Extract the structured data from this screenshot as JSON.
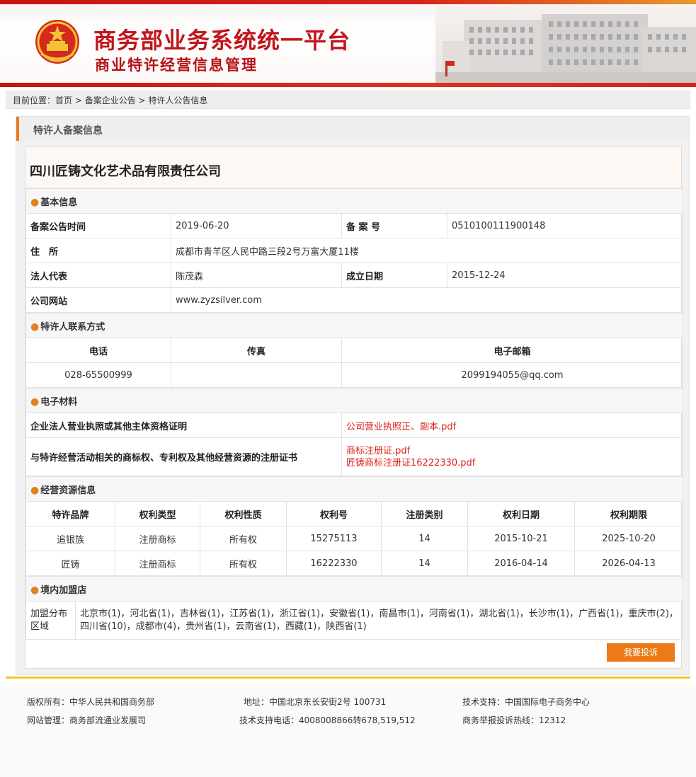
{
  "header": {
    "title": "商务部业务系统统一平台",
    "subtitle": "商业特许经营信息管理"
  },
  "breadcrumb": {
    "prefix": "目前位置：",
    "items": [
      "首页",
      "备案企业公告",
      "特许人公告信息"
    ],
    "sep": " > "
  },
  "panel": {
    "title": "特许人备案信息",
    "company": "四川匠铸文化艺术品有限责任公司"
  },
  "basic": {
    "section": "基本信息",
    "filing_date_label": "备案公告时间",
    "filing_date": "2019-06-20",
    "record_no_label": "备 案 号",
    "record_no": "0510100111900148",
    "address_label": "住　所",
    "address": "成都市青羊区人民中路三段2号万富大厦11楼",
    "legal_rep_label": "法人代表",
    "legal_rep": "陈茂森",
    "founded_label": "成立日期",
    "founded": "2015-12-24",
    "website_label": "公司网站",
    "website": "www.zyzsilver.com"
  },
  "contact": {
    "section": "特许人联系方式",
    "phone_label": "电话",
    "fax_label": "传真",
    "email_label": "电子邮箱",
    "phone": "028-65500999",
    "fax": "",
    "email": "2099194055@qq.com"
  },
  "materials": {
    "section": "电子材料",
    "row1_label": "企业法人营业执照或其他主体资格证明",
    "row1_file": "公司营业执照正、副本.pdf",
    "row2_label": "与特许经营活动相关的商标权、专利权及其他经营资源的注册证书",
    "row2_file1": "商标注册证.pdf",
    "row2_file2": "匠铸商标注册证16222330.pdf"
  },
  "resources": {
    "section": "经营资源信息",
    "headers": [
      "特许品牌",
      "权利类型",
      "权利性质",
      "权利号",
      "注册类别",
      "权利日期",
      "权利期限"
    ],
    "rows": [
      [
        "追银族",
        "注册商标",
        "所有权",
        "15275113",
        "14",
        "2015-10-21",
        "2025-10-20"
      ],
      [
        "匠铸",
        "注册商标",
        "所有权",
        "16222330",
        "14",
        "2016-04-14",
        "2026-04-13"
      ]
    ]
  },
  "stores": {
    "section": "境内加盟店",
    "label": "加盟分布区域",
    "value": "北京市(1)，河北省(1)，吉林省(1)，江苏省(1)，浙江省(1)，安徽省(1)，南昌市(1)，河南省(1)，湖北省(1)，长沙市(1)，广西省(1)，重庆市(2)，四川省(10)，成都市(4)，贵州省(1)，云南省(1)，西藏(1)，陕西省(1)"
  },
  "complain_button": "我要投诉",
  "footer": {
    "copyright": "版权所有：中华人民共和国商务部",
    "address": "地址：中国北京东长安街2号 100731",
    "tech_support": "技术支持：中国国际电子商务中心",
    "site_admin": "网站管理：商务部流通业发展司",
    "tech_phone": "技术支持电话：4008008866转678,519,512",
    "hotline": "商务举报投诉热线：12312"
  },
  "colors": {
    "brand_red": "#c1151a",
    "accent_orange": "#ec7a16",
    "link_red": "#d9231a"
  }
}
